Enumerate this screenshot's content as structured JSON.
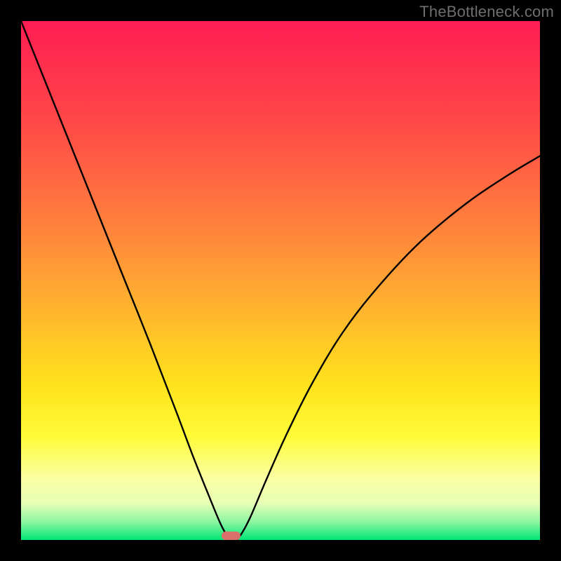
{
  "watermark": "TheBottleneck.com",
  "colors": {
    "frame": "#000000",
    "curve": "#000000",
    "marker": "#d9716a",
    "gradient_stops": [
      {
        "pct": 0.0,
        "color": "#ff1d53"
      },
      {
        "pct": 0.2,
        "color": "#ff4947"
      },
      {
        "pct": 0.4,
        "color": "#ff833c"
      },
      {
        "pct": 0.55,
        "color": "#ffb22f"
      },
      {
        "pct": 0.7,
        "color": "#ffe21c"
      },
      {
        "pct": 0.8,
        "color": "#fffb36"
      },
      {
        "pct": 0.88,
        "color": "#fbffa3"
      },
      {
        "pct": 0.93,
        "color": "#e6ffb6"
      },
      {
        "pct": 0.965,
        "color": "#8cf6a1"
      },
      {
        "pct": 1.0,
        "color": "#00e676"
      }
    ]
  },
  "chart_data": {
    "type": "line",
    "title": "",
    "xlabel": "",
    "ylabel": "",
    "xlim": [
      0,
      1
    ],
    "ylim": [
      0,
      1
    ],
    "grid": false,
    "legend": false,
    "series": [
      {
        "name": "bottleneck-curve",
        "x": [
          0.0,
          0.05,
          0.1,
          0.15,
          0.2,
          0.25,
          0.3,
          0.33,
          0.36,
          0.385,
          0.4,
          0.41,
          0.42,
          0.44,
          0.47,
          0.51,
          0.56,
          0.62,
          0.69,
          0.77,
          0.86,
          0.94,
          1.0
        ],
        "y": [
          1.0,
          0.875,
          0.75,
          0.625,
          0.5,
          0.375,
          0.245,
          0.165,
          0.09,
          0.03,
          0.005,
          0.0,
          0.005,
          0.04,
          0.11,
          0.2,
          0.3,
          0.4,
          0.49,
          0.575,
          0.65,
          0.704,
          0.74
        ]
      }
    ],
    "marker": {
      "x": 0.405,
      "y": 0.0,
      "width_frac": 0.036,
      "height_frac": 0.016
    }
  }
}
